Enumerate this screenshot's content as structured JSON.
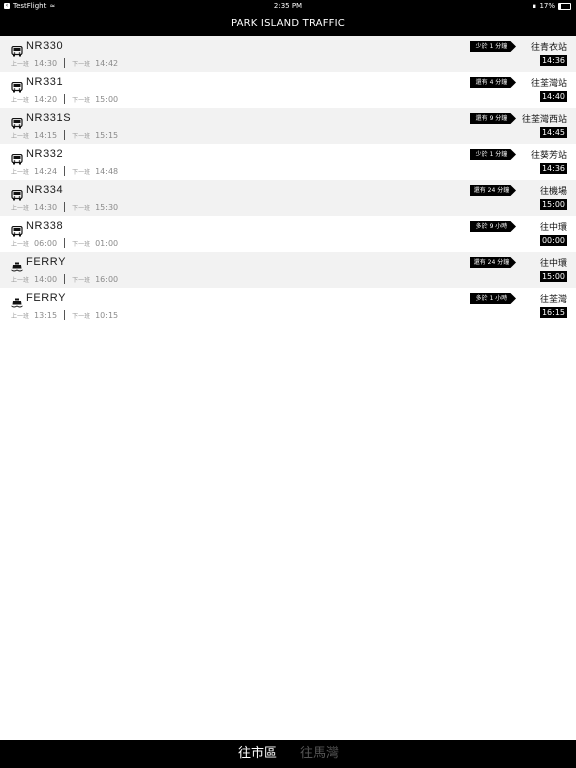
{
  "status_bar": {
    "back_app": "TestFlight",
    "time": "2:35 PM",
    "battery": "17%"
  },
  "nav": {
    "title": "PARK ISLAND TRAFFIC"
  },
  "labels": {
    "prev": "上一班",
    "next": "下一班"
  },
  "routes": [
    {
      "icon": "bus-icon",
      "name": "NR330",
      "prev": "14:30",
      "next": "14:42",
      "badge": "少於 1 分鐘",
      "dest": "往青衣站",
      "dep": "14:36"
    },
    {
      "icon": "bus-icon",
      "name": "NR331",
      "prev": "14:20",
      "next": "15:00",
      "badge": "還有 4 分鐘",
      "dest": "往荃灣站",
      "dep": "14:40"
    },
    {
      "icon": "bus-icon",
      "name": "NR331S",
      "prev": "14:15",
      "next": "15:15",
      "badge": "還有 9 分鐘",
      "dest": "往荃灣西站",
      "dep": "14:45"
    },
    {
      "icon": "bus-icon",
      "name": "NR332",
      "prev": "14:24",
      "next": "14:48",
      "badge": "少於 1 分鐘",
      "dest": "往葵芳站",
      "dep": "14:36"
    },
    {
      "icon": "bus-icon",
      "name": "NR334",
      "prev": "14:30",
      "next": "15:30",
      "badge": "還有 24 分鐘",
      "dest": "往機場",
      "dep": "15:00"
    },
    {
      "icon": "bus-icon",
      "name": "NR338",
      "prev": "06:00",
      "next": "01:00",
      "badge": "多於 9 小時",
      "dest": "往中環",
      "dep": "00:00"
    },
    {
      "icon": "ferry-icon",
      "name": "FERRY",
      "prev": "14:00",
      "next": "16:00",
      "badge": "還有 24 分鐘",
      "dest": "往中環",
      "dep": "15:00"
    },
    {
      "icon": "ferry-icon",
      "name": "FERRY",
      "prev": "13:15",
      "next": "10:15",
      "badge": "多於 1 小時",
      "dest": "往荃灣",
      "dep": "16:15"
    }
  ],
  "tabs": [
    {
      "label": "往市區",
      "active": true
    },
    {
      "label": "往馬灣",
      "active": false
    }
  ]
}
